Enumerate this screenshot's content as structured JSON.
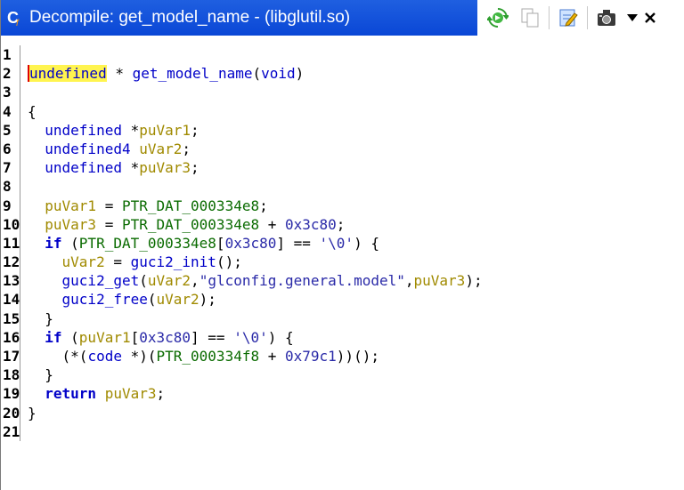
{
  "window": {
    "title": "Decompile: get_model_name -  (libglutil.so)",
    "title_icon": "decompiler-icon",
    "toolbar": [
      {
        "name": "refresh-icon"
      },
      {
        "name": "copy-icon"
      },
      {
        "name": "edit-icon"
      },
      {
        "name": "snapshot-icon"
      },
      {
        "name": "dropdown-arrow-icon"
      },
      {
        "name": "close-icon"
      }
    ]
  },
  "colors": {
    "titlebar": "#0a47d6",
    "keyword": "#0000c8",
    "variable": "#a08a00",
    "global": "#0a6b00",
    "highlight": "#fff44f"
  },
  "code": {
    "line_numbers": [
      "1",
      "2",
      "3",
      "4",
      "5",
      "6",
      "7",
      "8",
      "9",
      "10",
      "11",
      "12",
      "13",
      "14",
      "15",
      "16",
      "17",
      "18",
      "19",
      "20",
      "21"
    ],
    "lines": [
      {
        "tokens": []
      },
      {
        "tokens": [
          {
            "t": "undefined",
            "c": "type hl cursor"
          },
          {
            "t": " * ",
            "c": "plain"
          },
          {
            "t": "get_model_name",
            "c": "fn"
          },
          {
            "t": "(",
            "c": "plain"
          },
          {
            "t": "void",
            "c": "type"
          },
          {
            "t": ")",
            "c": "plain"
          }
        ]
      },
      {
        "tokens": []
      },
      {
        "tokens": [
          {
            "t": "{",
            "c": "plain"
          }
        ]
      },
      {
        "tokens": [
          {
            "t": "  undefined",
            "c": "type"
          },
          {
            "t": " *",
            "c": "plain"
          },
          {
            "t": "puVar1",
            "c": "var"
          },
          {
            "t": ";",
            "c": "plain"
          }
        ]
      },
      {
        "tokens": [
          {
            "t": "  undefined4",
            "c": "type"
          },
          {
            "t": " ",
            "c": "plain"
          },
          {
            "t": "uVar2",
            "c": "var"
          },
          {
            "t": ";",
            "c": "plain"
          }
        ]
      },
      {
        "tokens": [
          {
            "t": "  undefined",
            "c": "type"
          },
          {
            "t": " *",
            "c": "plain"
          },
          {
            "t": "puVar3",
            "c": "var"
          },
          {
            "t": ";",
            "c": "plain"
          }
        ]
      },
      {
        "tokens": []
      },
      {
        "tokens": [
          {
            "t": "  puVar1",
            "c": "var"
          },
          {
            "t": " = ",
            "c": "plain"
          },
          {
            "t": "PTR_DAT_000334e8",
            "c": "glob"
          },
          {
            "t": ";",
            "c": "plain"
          }
        ]
      },
      {
        "tokens": [
          {
            "t": "  puVar3",
            "c": "var"
          },
          {
            "t": " = ",
            "c": "plain"
          },
          {
            "t": "PTR_DAT_000334e8",
            "c": "glob"
          },
          {
            "t": " + ",
            "c": "plain"
          },
          {
            "t": "0x3c80",
            "c": "num"
          },
          {
            "t": ";",
            "c": "plain"
          }
        ]
      },
      {
        "tokens": [
          {
            "t": "  if",
            "c": "kw"
          },
          {
            "t": " (",
            "c": "plain"
          },
          {
            "t": "PTR_DAT_000334e8",
            "c": "glob"
          },
          {
            "t": "[",
            "c": "plain"
          },
          {
            "t": "0x3c80",
            "c": "num"
          },
          {
            "t": "] == ",
            "c": "plain"
          },
          {
            "t": "'\\0'",
            "c": "str"
          },
          {
            "t": ") {",
            "c": "plain"
          }
        ]
      },
      {
        "tokens": [
          {
            "t": "    uVar2",
            "c": "var"
          },
          {
            "t": " = ",
            "c": "plain"
          },
          {
            "t": "guci2_init",
            "c": "fn"
          },
          {
            "t": "();",
            "c": "plain"
          }
        ]
      },
      {
        "tokens": [
          {
            "t": "    guci2_get",
            "c": "fn"
          },
          {
            "t": "(",
            "c": "plain"
          },
          {
            "t": "uVar2",
            "c": "var"
          },
          {
            "t": ",",
            "c": "plain"
          },
          {
            "t": "\"glconfig.general.model\"",
            "c": "str"
          },
          {
            "t": ",",
            "c": "plain"
          },
          {
            "t": "puVar3",
            "c": "var"
          },
          {
            "t": ");",
            "c": "plain"
          }
        ]
      },
      {
        "tokens": [
          {
            "t": "    guci2_free",
            "c": "fn"
          },
          {
            "t": "(",
            "c": "plain"
          },
          {
            "t": "uVar2",
            "c": "var"
          },
          {
            "t": ");",
            "c": "plain"
          }
        ]
      },
      {
        "tokens": [
          {
            "t": "  }",
            "c": "plain"
          }
        ]
      },
      {
        "tokens": [
          {
            "t": "  if",
            "c": "kw"
          },
          {
            "t": " (",
            "c": "plain"
          },
          {
            "t": "puVar1",
            "c": "var"
          },
          {
            "t": "[",
            "c": "plain"
          },
          {
            "t": "0x3c80",
            "c": "num"
          },
          {
            "t": "] == ",
            "c": "plain"
          },
          {
            "t": "'\\0'",
            "c": "str"
          },
          {
            "t": ") {",
            "c": "plain"
          }
        ]
      },
      {
        "tokens": [
          {
            "t": "    (*(",
            "c": "plain"
          },
          {
            "t": "code",
            "c": "type"
          },
          {
            "t": " *)(",
            "c": "plain"
          },
          {
            "t": "PTR_000334f8",
            "c": "glob"
          },
          {
            "t": " + ",
            "c": "plain"
          },
          {
            "t": "0x79c1",
            "c": "num"
          },
          {
            "t": "))();",
            "c": "plain"
          }
        ]
      },
      {
        "tokens": [
          {
            "t": "  }",
            "c": "plain"
          }
        ]
      },
      {
        "tokens": [
          {
            "t": "  return",
            "c": "kw"
          },
          {
            "t": " ",
            "c": "plain"
          },
          {
            "t": "puVar3",
            "c": "var"
          },
          {
            "t": ";",
            "c": "plain"
          }
        ]
      },
      {
        "tokens": [
          {
            "t": "}",
            "c": "plain"
          }
        ]
      },
      {
        "tokens": []
      }
    ]
  }
}
